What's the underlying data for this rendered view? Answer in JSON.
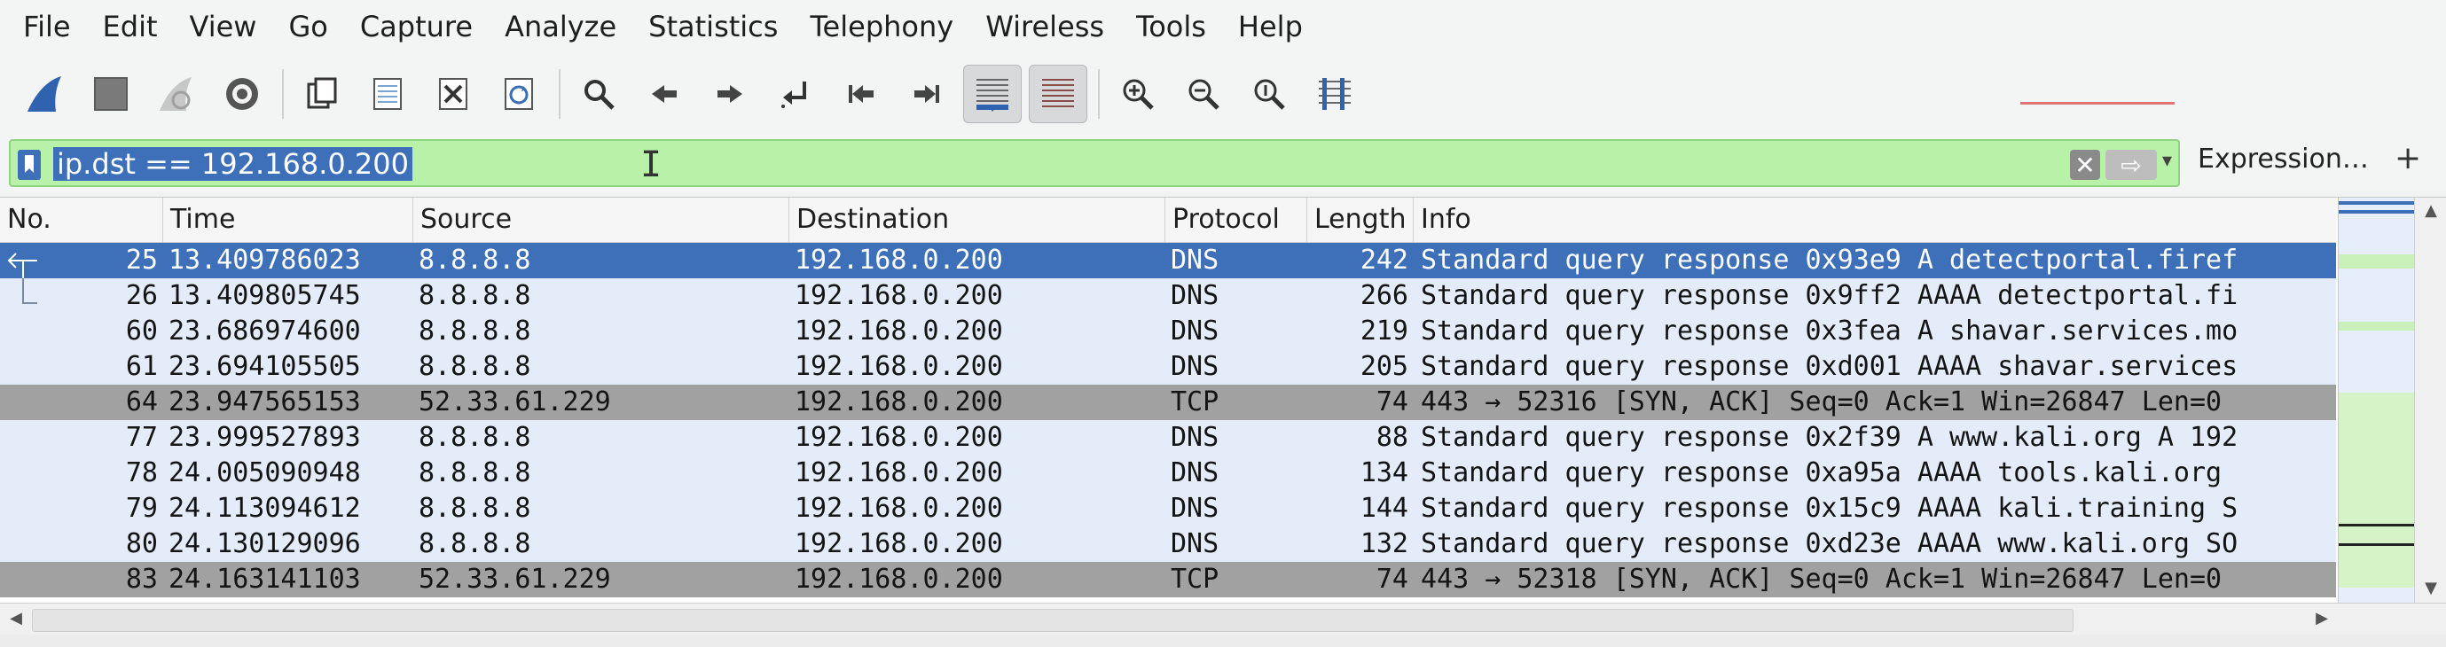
{
  "menu": [
    "File",
    "Edit",
    "View",
    "Go",
    "Capture",
    "Analyze",
    "Statistics",
    "Telephony",
    "Wireless",
    "Tools",
    "Help"
  ],
  "toolbar": {
    "icons": [
      "shark-fin-start-icon",
      "stop-square-icon",
      "restart-capture-icon",
      "capture-options-icon",
      "open-file-icon",
      "save-file-icon",
      "close-file-icon",
      "reload-file-icon",
      "find-packet-icon",
      "go-back-icon",
      "go-forward-icon",
      "go-to-packet-icon",
      "go-first-icon",
      "go-last-icon",
      "auto-scroll-icon",
      "colorize-icon",
      "zoom-in-icon",
      "zoom-out-icon",
      "normal-size-icon",
      "resize-columns-icon"
    ]
  },
  "filter": {
    "value": "ip.dst == 192.168.0.200",
    "expression_label": "Expression…",
    "add_label": "+",
    "color": "#b8f1a8"
  },
  "columns": [
    "No.",
    "Time",
    "Source",
    "Destination",
    "Protocol",
    "Length",
    "Info"
  ],
  "packets": [
    {
      "no": "25",
      "time": "13.409786023",
      "src": "8.8.8.8",
      "dst": "192.168.0.200",
      "proto": "DNS",
      "len": "242",
      "info": "Standard query response 0x93e9 A detectportal.firef",
      "selected": true
    },
    {
      "no": "26",
      "time": "13.409805745",
      "src": "8.8.8.8",
      "dst": "192.168.0.200",
      "proto": "DNS",
      "len": "266",
      "info": "Standard query response 0x9ff2 AAAA detectportal.fi"
    },
    {
      "no": "60",
      "time": "23.686974600",
      "src": "8.8.8.8",
      "dst": "192.168.0.200",
      "proto": "DNS",
      "len": "219",
      "info": "Standard query response 0x3fea A shavar.services.mo"
    },
    {
      "no": "61",
      "time": "23.694105505",
      "src": "8.8.8.8",
      "dst": "192.168.0.200",
      "proto": "DNS",
      "len": "205",
      "info": "Standard query response 0xd001 AAAA shavar.services"
    },
    {
      "no": "64",
      "time": "23.947565153",
      "src": "52.33.61.229",
      "dst": "192.168.0.200",
      "proto": "TCP",
      "len": "74",
      "info": "443 → 52316 [SYN, ACK] Seq=0 Ack=1 Win=26847 Len=0"
    },
    {
      "no": "77",
      "time": "23.999527893",
      "src": "8.8.8.8",
      "dst": "192.168.0.200",
      "proto": "DNS",
      "len": "88",
      "info": "Standard query response 0x2f39 A www.kali.org A 192"
    },
    {
      "no": "78",
      "time": "24.005090948",
      "src": "8.8.8.8",
      "dst": "192.168.0.200",
      "proto": "DNS",
      "len": "134",
      "info": "Standard query response 0xa95a AAAA tools.kali.org"
    },
    {
      "no": "79",
      "time": "24.113094612",
      "src": "8.8.8.8",
      "dst": "192.168.0.200",
      "proto": "DNS",
      "len": "144",
      "info": "Standard query response 0x15c9 AAAA kali.training S"
    },
    {
      "no": "80",
      "time": "24.130129096",
      "src": "8.8.8.8",
      "dst": "192.168.0.200",
      "proto": "DNS",
      "len": "132",
      "info": "Standard query response 0xd23e AAAA www.kali.org SO"
    },
    {
      "no": "83",
      "time": "24.163141103",
      "src": "52.33.61.229",
      "dst": "192.168.0.200",
      "proto": "TCP",
      "len": "74",
      "info": "443 → 52318 [SYN, ACK] Seq=0 Ack=1 Win=26847 Len=0"
    }
  ],
  "colors": {
    "dns_row": "#e3ecf8",
    "tcp_row": "#a1a1a1",
    "selected_row": "#3d70b8",
    "filter_ok": "#b8f1a8"
  }
}
